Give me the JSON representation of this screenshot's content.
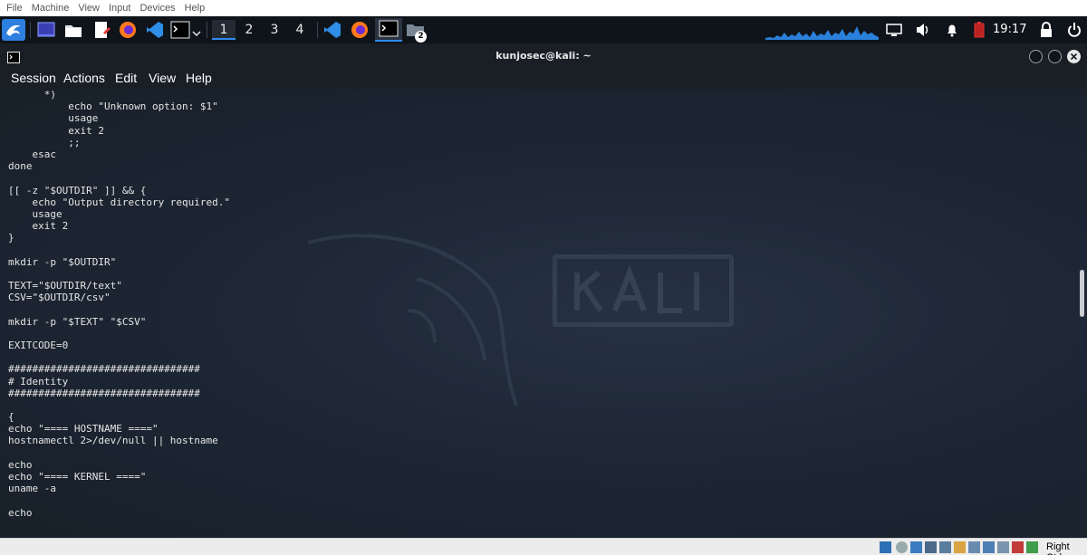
{
  "vbox_menu": {
    "items": [
      "File",
      "Machine",
      "View",
      "Input",
      "Devices",
      "Help"
    ]
  },
  "panel": {
    "launchers": [
      "kali-menu-icon",
      "desktop-icon",
      "file-manager-icon",
      "text-editor-icon",
      "firefox-icon",
      "vscode-icon",
      "terminal-icon"
    ],
    "workspaces": [
      "1",
      "2",
      "3",
      "4"
    ],
    "active_workspace": 0,
    "files_badge": "2",
    "clock": "19:17"
  },
  "terminal": {
    "title": "kunjosec@kali: ~",
    "menu": [
      "Session",
      "Actions",
      "Edit",
      "View",
      "Help"
    ],
    "lines": [
      "      *)",
      "          echo \"Unknown option: $1\"",
      "          usage",
      "          exit 2",
      "          ;;",
      "    esac",
      "done",
      "",
      "[[ -z \"$OUTDIR\" ]] && {",
      "    echo \"Output directory required.\"",
      "    usage",
      "    exit 2",
      "}",
      "",
      "mkdir -p \"$OUTDIR\"",
      "",
      "TEXT=\"$OUTDIR/text\"",
      "CSV=\"$OUTDIR/csv\"",
      "",
      "mkdir -p \"$TEXT\" \"$CSV\"",
      "",
      "EXITCODE=0",
      "",
      "################################",
      "# Identity",
      "################################",
      "",
      "{",
      "echo \"==== HOSTNAME ====\"",
      "hostnamectl 2>/dev/null || hostname",
      "",
      "echo",
      "echo \"==== KERNEL ====\"",
      "uname -a",
      "",
      "echo"
    ]
  },
  "statusbar": {
    "host_key": "Right Ctrl"
  },
  "colors": {
    "accent": "#2d8cf0",
    "terminal_bg": "#1b2330",
    "panel_bg": "#0f141a"
  }
}
